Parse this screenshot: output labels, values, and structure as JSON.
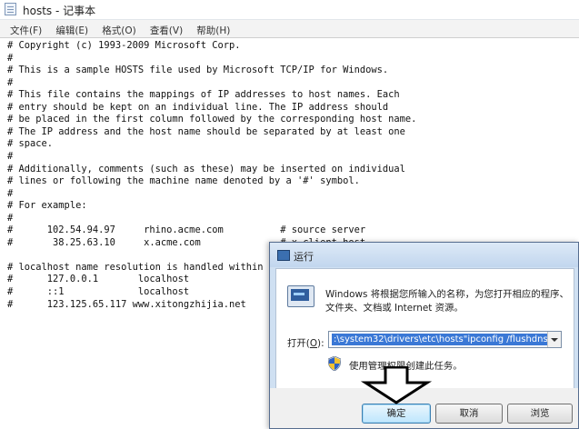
{
  "notepad": {
    "title": "hosts - 记事本",
    "menu": [
      "文件(F)",
      "编辑(E)",
      "格式(O)",
      "查看(V)",
      "帮助(H)"
    ],
    "lines": [
      "# Copyright (c) 1993-2009 Microsoft Corp.",
      "#",
      "# This is a sample HOSTS file used by Microsoft TCP/IP for Windows.",
      "#",
      "# This file contains the mappings of IP addresses to host names. Each",
      "# entry should be kept on an individual line. The IP address should",
      "# be placed in the first column followed by the corresponding host name.",
      "# The IP address and the host name should be separated by at least one",
      "# space.",
      "#",
      "# Additionally, comments (such as these) may be inserted on individual",
      "# lines or following the machine name denoted by a '#' symbol.",
      "#",
      "# For example:",
      "#",
      "#      102.54.94.97     rhino.acme.com          # source server",
      "#       38.25.63.10     x.acme.com              # x client host",
      "",
      "# localhost name resolution is handled within DNS itself.",
      "#      127.0.0.1       localhost",
      "#      ::1             localhost",
      "#      123.125.65.117 www.xitongzhijia.net"
    ]
  },
  "run_dialog": {
    "title": "运行",
    "description": "Windows 将根据您所输入的名称，为您打开相应的程序、文件夹、文档或 Internet 资源。",
    "open_label": "打开(O):",
    "command": ":\\system32\\drivers\\etc\\hosts\"ipconfig /flushdnsexit",
    "admin_note": "使用管理权限创建此任务。",
    "buttons": {
      "ok": "确定",
      "cancel": "取消",
      "browse": "浏览"
    }
  },
  "icons": [
    "notepad-icon",
    "run-icon",
    "run-program-icon",
    "uac-shield-icon",
    "dropdown-arrow-icon",
    "down-arrow-annotation-icon"
  ]
}
